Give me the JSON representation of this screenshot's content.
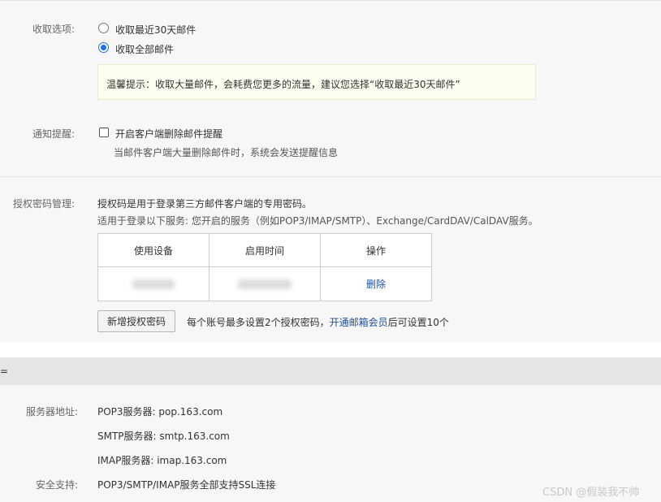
{
  "receive": {
    "label": "收取选项:",
    "option_recent": "收取最近30天邮件",
    "option_all": "收取全部邮件",
    "selected": "收取全部邮件",
    "tip": "温馨提示：收取大量邮件，会耗费您更多的流量，建议您选择“收取最近30天邮件”"
  },
  "notify": {
    "label": "通知提醒:",
    "checkbox_label": "开启客户端删除邮件提醒",
    "checked": false,
    "description": "当邮件客户端大量删除邮件时，系统会发送提醒信息"
  },
  "auth": {
    "label": "授权密码管理:",
    "description": "授权码是用于登录第三方邮件客户端的专用密码。",
    "services": "适用于登录以下服务: 您开启的服务（例如POP3/IMAP/SMTP）、Exchange/CardDAV/CalDAV服务。",
    "table": {
      "headers": [
        "使用设备",
        "启用时间",
        "操作"
      ],
      "rows": [
        {
          "action": "删除"
        }
      ]
    },
    "add_button": "新增授权密码",
    "limit_text": "每个账号最多设置2个授权密码，",
    "vip_link": "开通邮箱会员",
    "limit_suffix": "后可设置10个"
  },
  "section_header": {
    "title": "="
  },
  "server": {
    "address_label": "服务器地址:",
    "pop3": "POP3服务器: pop.163.com",
    "smtp": "SMTP服务器: smtp.163.com",
    "imap": "IMAP服务器: imap.163.com",
    "security_label": "安全支持:",
    "security": "POP3/SMTP/IMAP服务全部支持SSL连接"
  },
  "watermark": "CSDN @假装我不帅",
  "colors": {
    "accent": "#1a73e8",
    "link": "#1f4e9c",
    "tip_bg": "#fdfdf0",
    "header_bg": "#e5e5e5"
  }
}
